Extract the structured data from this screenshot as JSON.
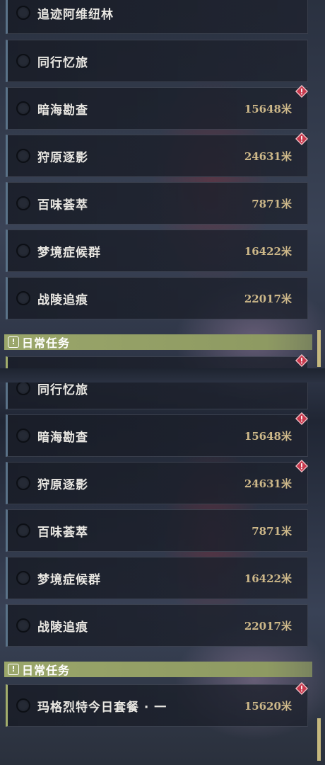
{
  "top_panel": {
    "quests_before": [
      {
        "name": "追迹阿维纽林",
        "distance": "",
        "alert": false
      },
      {
        "name": "同行忆旅",
        "distance": "",
        "alert": false
      },
      {
        "name": "暗海勘查",
        "distance": "15648米",
        "alert": true
      },
      {
        "name": "狩原逐影",
        "distance": "24631米",
        "alert": true
      },
      {
        "name": "百味荟萃",
        "distance": "7871米",
        "alert": false
      },
      {
        "name": "梦境症候群",
        "distance": "16422米",
        "alert": false
      },
      {
        "name": "战陵追痕",
        "distance": "22017米",
        "alert": false
      }
    ],
    "section_title": "日常任务",
    "section_icon": "exclamation-box-icon",
    "partial_daily_alert": true
  },
  "bottom_panel": {
    "quests_before": [
      {
        "name": "同行忆旅",
        "distance": "",
        "alert": false
      },
      {
        "name": "暗海勘查",
        "distance": "15648米",
        "alert": true
      },
      {
        "name": "狩原逐影",
        "distance": "24631米",
        "alert": true
      },
      {
        "name": "百味荟萃",
        "distance": "7871米",
        "alert": false
      },
      {
        "name": "梦境症候群",
        "distance": "16422米",
        "alert": false
      },
      {
        "name": "战陵追痕",
        "distance": "22017米",
        "alert": false
      }
    ],
    "section_title": "日常任务",
    "section_icon": "exclamation-box-icon",
    "daily_quests": [
      {
        "name": "玛格烈特今日套餐 · 一",
        "distance": "15620米",
        "alert": true
      }
    ]
  },
  "colors": {
    "section_header": "#9aa66a",
    "distance_text": "#cdb889",
    "alert_badge": "#c8384c",
    "scrollbar": "#c5b87e"
  }
}
